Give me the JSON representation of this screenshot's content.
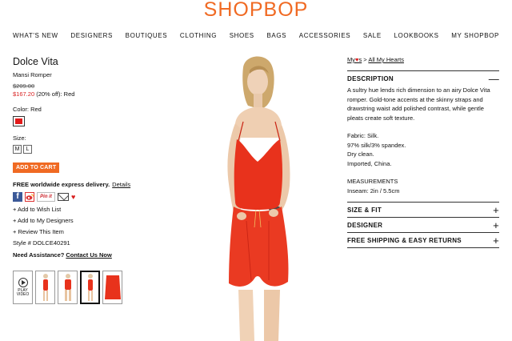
{
  "logo": "SHOPBOP",
  "nav": [
    "WHAT'S NEW",
    "DESIGNERS",
    "BOUTIQUES",
    "CLOTHING",
    "SHOES",
    "BAGS",
    "ACCESSORIES",
    "SALE",
    "LOOKBOOKS",
    "MY SHOPBOP"
  ],
  "product": {
    "brand": "Dolce Vita",
    "name": "Mansi Romper",
    "old_price": "$209.00",
    "sale_price": "$167.20",
    "sale_suffix": " (20% off): Red",
    "color_label": "Color: Red",
    "swatch_color": "#e21b1b",
    "size_label": "Size:",
    "sizes": [
      "M",
      "L"
    ],
    "add_to_cart": "ADD TO CART",
    "free_delivery": "FREE worldwide express delivery.",
    "details_link": "Details",
    "social": {
      "facebook": "f",
      "pinterest": "Pin it"
    },
    "add_wish": "+ Add to Wish List",
    "add_designers": "+ Add to My Designers",
    "review": "+ Review This Item",
    "style": "Style # DOLCE40291",
    "need_assistance": "Need Assistance?",
    "contact": "Contact Us Now",
    "play_video": "PLAY VIDEO"
  },
  "breadcrumb": {
    "my": "My",
    "s": "s",
    "sep": ">",
    "all": "All My Hearts"
  },
  "sections": {
    "description": {
      "title": "DESCRIPTION",
      "toggle": "—",
      "para1": "A sultry hue lends rich dimension to an airy Dolce Vita romper. Gold-tone accents at the skinny straps and drawstring waist add polished contrast, while gentle pleats create soft texture.",
      "fabric": [
        "Fabric: Silk.",
        "97% silk/3% spandex.",
        "Dry clean.",
        "Imported, China."
      ],
      "measure_title": "MEASUREMENTS",
      "inseam": "Inseam: 2in / 5.5cm"
    },
    "size_fit": {
      "title": "SIZE & FIT",
      "toggle": "+"
    },
    "designer": {
      "title": "DESIGNER",
      "toggle": "+"
    },
    "shipping": {
      "title": "FREE SHIPPING & EASY RETURNS",
      "toggle": "+"
    }
  },
  "colors": {
    "brand_orange": "#f06a23",
    "sale_red": "#d81e1e",
    "romper_red": "#e8321c"
  }
}
